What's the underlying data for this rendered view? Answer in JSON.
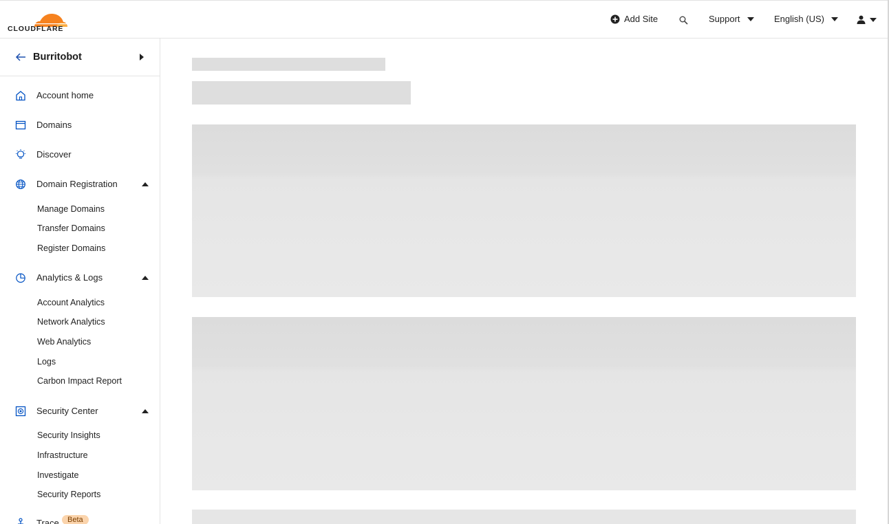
{
  "header": {
    "logo_text": "CLOUDFLARE",
    "add_site_label": "Add Site",
    "support_label": "Support",
    "language_label": "English (US)"
  },
  "sidebar": {
    "account_name": "Burritobot",
    "items": [
      {
        "label": "Account home",
        "icon": "home-icon"
      },
      {
        "label": "Domains",
        "icon": "browser-window-icon"
      },
      {
        "label": "Discover",
        "icon": "lightbulb-icon"
      },
      {
        "label": "Domain Registration",
        "icon": "globe-icon",
        "expanded": true,
        "children": [
          "Manage Domains",
          "Transfer Domains",
          "Register Domains"
        ]
      },
      {
        "label": "Analytics & Logs",
        "icon": "pie-chart-icon",
        "expanded": true,
        "children": [
          "Account Analytics",
          "Network Analytics",
          "Web Analytics",
          "Logs",
          "Carbon Impact Report"
        ]
      },
      {
        "label": "Security Center",
        "icon": "security-center-icon",
        "expanded": true,
        "children": [
          "Security Insights",
          "Infrastructure",
          "Investigate",
          "Security Reports"
        ]
      },
      {
        "label": "Trace",
        "icon": "trace-icon",
        "badge": "Beta"
      }
    ]
  },
  "colors": {
    "brand_orange": "#f6821f",
    "nav_icon_blue": "#0051c3",
    "skeleton_gray": "#dedede",
    "beta_badge_bg": "#fbd4ac"
  },
  "main": {
    "state": "loading"
  }
}
